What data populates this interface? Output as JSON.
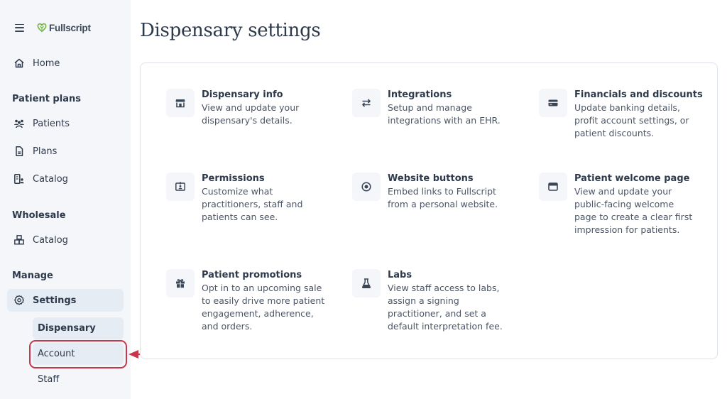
{
  "app": {
    "brand": "Fullscript"
  },
  "sidebar": {
    "home_label": "Home",
    "sections": {
      "patient_plans": {
        "title": "Patient plans",
        "items": [
          "Patients",
          "Plans",
          "Catalog"
        ]
      },
      "wholesale": {
        "title": "Wholesale",
        "items": [
          "Catalog"
        ]
      },
      "manage": {
        "title": "Manage",
        "items": [
          "Settings"
        ]
      }
    },
    "settings_sub": [
      "Dispensary",
      "Account",
      "Staff"
    ]
  },
  "page": {
    "title": "Dispensary settings"
  },
  "tiles": [
    {
      "icon": "storefront-icon",
      "title": "Dispensary info",
      "desc": "View and update your\ndispensary's details."
    },
    {
      "icon": "arrows-swap-icon",
      "title": "Integrations",
      "desc": "Setup and manage\nintegrations with an EHR."
    },
    {
      "icon": "credit-card-icon",
      "title": "Financials and discounts",
      "desc": "Update banking details,\nprofit account settings, or\npatient discounts."
    },
    {
      "icon": "id-badge-icon",
      "title": "Permissions",
      "desc": "Customize what\npractitioners, staff and\npatients can see."
    },
    {
      "icon": "radio-button-icon",
      "title": "Website buttons",
      "desc": "Embed links to Fullscript\nfrom a personal website."
    },
    {
      "icon": "browser-window-icon",
      "title": "Patient welcome page",
      "desc": "View and update your\npublic-facing welcome\npage to create a clear first\nimpression for patients."
    },
    {
      "icon": "gift-icon",
      "title": "Patient promotions",
      "desc": "Opt in to an upcoming sale\nto easily drive more patient\nengagement, adherence,\nand orders."
    },
    {
      "icon": "flask-icon",
      "title": "Labs",
      "desc": "View staff access to labs,\nassign a signing\npractitioner, and set a\ndefault interpretation fee."
    }
  ],
  "annotation": {
    "color": "#c8364a",
    "target": "Account"
  },
  "colors": {
    "brand_green": "#6fb33f",
    "sidebar_bg": "#f4f6fa",
    "active_bg": "#e6ecf4"
  }
}
